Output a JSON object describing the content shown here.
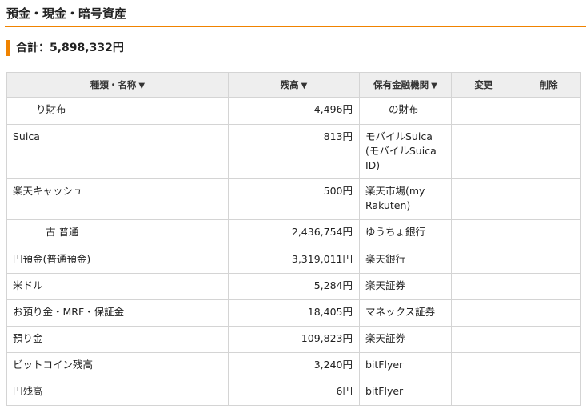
{
  "section": {
    "title": "預金・現金・暗号資産"
  },
  "total": {
    "label": "合計：5,898,332円"
  },
  "table": {
    "headers": {
      "name": "種類・名称",
      "balance": "残高",
      "institution": "保有金融機関",
      "edit": "変更",
      "delete": "削除",
      "sort_glyph": "▼"
    },
    "rows": [
      {
        "name": "り財布",
        "balance": "4,496円",
        "institution": "の財布",
        "edit": "",
        "delete": ""
      },
      {
        "name": "Suica",
        "balance": "813円",
        "institution": "モバイルSuica (モバイルSuica ID)",
        "edit": "",
        "delete": ""
      },
      {
        "name": "楽天キャッシュ",
        "balance": "500円",
        "institution": "楽天市場(my Rakuten)",
        "edit": "",
        "delete": ""
      },
      {
        "name": "古 普通",
        "balance": "2,436,754円",
        "institution": "ゆうちょ銀行",
        "edit": "",
        "delete": ""
      },
      {
        "name": "円預金(普通預金)",
        "balance": "3,319,011円",
        "institution": "楽天銀行",
        "edit": "",
        "delete": ""
      },
      {
        "name": "米ドル",
        "balance": "5,284円",
        "institution": "楽天証券",
        "edit": "",
        "delete": ""
      },
      {
        "name": "お預り金・MRF・保証金",
        "balance": "18,405円",
        "institution": "マネックス証券",
        "edit": "",
        "delete": ""
      },
      {
        "name": "預り金",
        "balance": "109,823円",
        "institution": "楽天証券",
        "edit": "",
        "delete": ""
      },
      {
        "name": "ビットコイン残高",
        "balance": "3,240円",
        "institution": "bitFlyer",
        "edit": "",
        "delete": ""
      },
      {
        "name": "円残高",
        "balance": "6円",
        "institution": "bitFlyer",
        "edit": "",
        "delete": ""
      }
    ]
  },
  "colors": {
    "accent": "#f08300",
    "header_bg": "#eeeeee",
    "border": "#d4d4d4"
  }
}
